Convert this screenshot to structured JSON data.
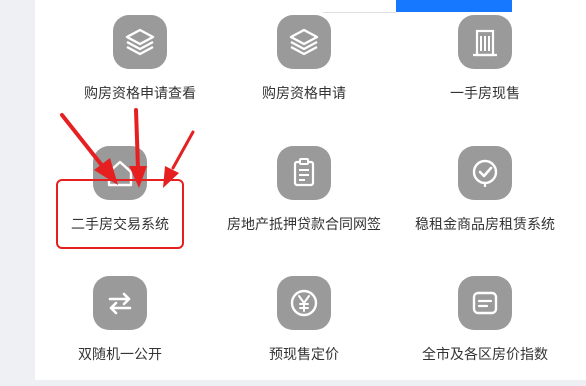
{
  "topbar": {
    "left_tab": "",
    "right_tab": ""
  },
  "tiles": [
    {
      "label": "购房资格申请查看",
      "icon": "layers-icon"
    },
    {
      "label": "购房资格申请",
      "icon": "layers-icon"
    },
    {
      "label": "一手房现售",
      "icon": "building-icon"
    },
    {
      "label": "二手房交易系统",
      "icon": "house-icon"
    },
    {
      "label": "房地产抵押贷款合同网签",
      "icon": "document-icon"
    },
    {
      "label": "稳租金商品房租赁系统",
      "icon": "check-badge-icon"
    },
    {
      "label": "双随机一公开",
      "icon": "swap-arrows-icon"
    },
    {
      "label": "预现售定价",
      "icon": "yen-coin-icon"
    },
    {
      "label": "全市及各区房价指数",
      "icon": "message-icon"
    }
  ],
  "colors": {
    "highlight": "#e62020",
    "icon_bg": "#9a9a9a",
    "accent": "#1677ff"
  }
}
